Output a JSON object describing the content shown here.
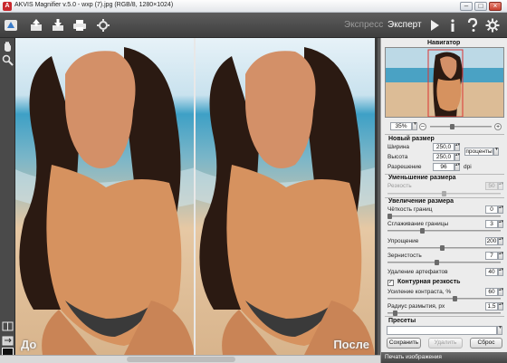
{
  "window": {
    "title": "AKVIS Magnifier v.5.0 - wxp (7).jpg (RGB/8, 1280×1024)",
    "minimize": "–",
    "maximize": "□",
    "close": "×"
  },
  "toolbar": {
    "mode_express": "Экспресс",
    "mode_expert": "Эксперт",
    "icons": [
      "app-logo-icon",
      "open-icon",
      "save-icon",
      "print-icon",
      "settings-gear-icon",
      "run-icon",
      "info-icon",
      "help-icon",
      "preferences-icon"
    ]
  },
  "canvas": {
    "label_before": "До",
    "label_after": "После"
  },
  "navigator": {
    "title": "Навигатор",
    "zoom": "35%"
  },
  "new_size": {
    "title": "Новый размер",
    "width_label": "Ширина",
    "width_value": "250,0",
    "height_label": "Высота",
    "height_value": "250,0",
    "units": "проценты",
    "resolution_label": "Разрешение",
    "resolution_value": "96",
    "resolution_unit": "dpi"
  },
  "downscale": {
    "title": "Уменьшение размера",
    "sharpness_label": "Резкость",
    "sharpness_value": "50"
  },
  "upscale": {
    "title": "Увеличение размера",
    "edge_sharpness_label": "Чёткость границ",
    "edge_sharpness_value": "0",
    "edge_smoothing_label": "Сглаживание границы",
    "edge_smoothing_value": "3",
    "simplification_label": "Упрощение",
    "simplification_value": "200",
    "graininess_label": "Зернистость",
    "graininess_value": "7",
    "artifact_removal_label": "Удаление артефактов",
    "artifact_removal_value": "40"
  },
  "contour_sharpness": {
    "title": "Контурная резкость",
    "checked": "✓",
    "contrast_label": "Усиление контраста, %",
    "contrast_value": "60",
    "radius_label": "Радиус размытия, px",
    "radius_value": "1,5"
  },
  "presets": {
    "title": "Пресеты",
    "save": "Сохранить",
    "delete": "Удалить",
    "reset": "Сброс"
  },
  "footer": "Печать изображения"
}
